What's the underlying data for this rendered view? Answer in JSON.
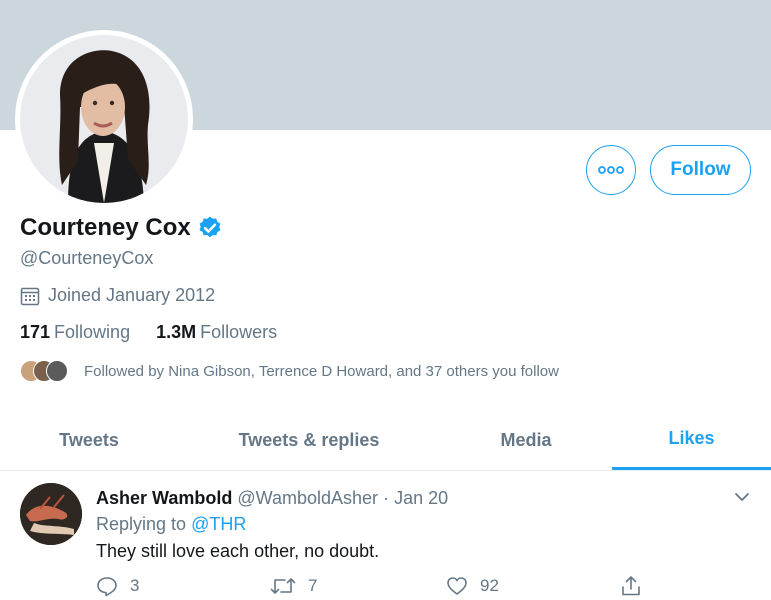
{
  "profile": {
    "display_name": "Courteney Cox",
    "handle": "@CourteneyCox",
    "joined": "Joined January 2012",
    "following_count": "171",
    "following_label": "Following",
    "followers_count": "1.3M",
    "followers_label": "Followers",
    "followed_by": "Followed by Nina Gibson, Terrence D Howard, and 37 others you follow"
  },
  "actions": {
    "follow_label": "Follow"
  },
  "tabs": [
    {
      "label": "Tweets"
    },
    {
      "label": "Tweets & replies"
    },
    {
      "label": "Media"
    },
    {
      "label": "Likes"
    }
  ],
  "tweet": {
    "author_name": "Asher Wambold",
    "author_handle": "@WamboldAsher",
    "separator": "·",
    "date": "Jan 20",
    "replying_prefix": "Replying to",
    "replying_to": "@THR",
    "text": "They still love each other, no doubt.",
    "reply_count": "3",
    "retweet_count": "7",
    "like_count": "92"
  },
  "colors": {
    "accent": "#1da1f2",
    "banner": "#ccd6dd",
    "secondary_text": "#657786"
  },
  "icons": [
    "more-icon",
    "verified-icon",
    "calendar-icon",
    "chevron-down-icon",
    "reply-icon",
    "retweet-icon",
    "like-icon",
    "share-icon"
  ]
}
